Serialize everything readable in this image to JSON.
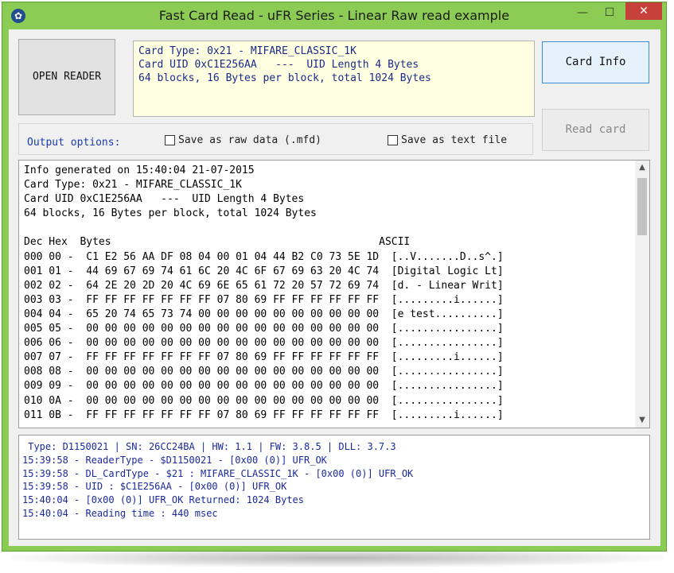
{
  "window": {
    "title": "Fast Card Read - uFR Series - Linear Raw read example",
    "icon": "paw-icon",
    "min_glyph": "—",
    "max_glyph": "☐",
    "close_glyph": "✕",
    "accent": "#8ccc55"
  },
  "buttons": {
    "open_reader": "OPEN READER",
    "card_info": "Card Info",
    "read_card": "Read card"
  },
  "card_info_box": [
    "Card Type: 0x21 - MIFARE_CLASSIC_1K",
    "Card UID 0xC1E256AA   ---  UID Length 4 Bytes",
    "64 blocks, 16 Bytes per block, total 1024 Bytes"
  ],
  "output_options": {
    "label": "Output options:",
    "save_raw": {
      "label": "Save as raw data (.mfd)",
      "checked": false
    },
    "save_text": {
      "label": "Save as text file",
      "checked": false
    }
  },
  "main_output": {
    "lines": [
      "Info generated on 15:40:04 21-07-2015",
      "Card Type: 0x21 - MIFARE_CLASSIC_1K",
      "Card UID 0xC1E256AA   ---  UID Length 4 Bytes",
      "64 blocks, 16 Bytes per block, total 1024 Bytes",
      "",
      "Dec Hex  Bytes                                           ASCII",
      "000 00 -  C1 E2 56 AA DF 08 04 00 01 04 44 B2 C0 73 5E 1D  [..V.......D..s^.]",
      "001 01 -  44 69 67 69 74 61 6C 20 4C 6F 67 69 63 20 4C 74  [Digital Logic Lt]",
      "002 02 -  64 2E 20 2D 20 4C 69 6E 65 61 72 20 57 72 69 74  [d. - Linear Writ]",
      "003 03 -  FF FF FF FF FF FF FF 07 80 69 FF FF FF FF FF FF  [.........i......]",
      "004 04 -  65 20 74 65 73 74 00 00 00 00 00 00 00 00 00 00  [e test..........]",
      "005 05 -  00 00 00 00 00 00 00 00 00 00 00 00 00 00 00 00  [................]",
      "006 06 -  00 00 00 00 00 00 00 00 00 00 00 00 00 00 00 00  [................]",
      "007 07 -  FF FF FF FF FF FF FF 07 80 69 FF FF FF FF FF FF  [.........i......]",
      "008 08 -  00 00 00 00 00 00 00 00 00 00 00 00 00 00 00 00  [................]",
      "009 09 -  00 00 00 00 00 00 00 00 00 00 00 00 00 00 00 00  [................]",
      "010 0A -  00 00 00 00 00 00 00 00 00 00 00 00 00 00 00 00  [................]",
      "011 0B -  FF FF FF FF FF FF FF 07 80 69 FF FF FF FF FF FF  [.........i......]"
    ]
  },
  "log": {
    "lines": [
      " Type: D1150021 | SN: 26CC24BA | HW: 1.1 | FW: 3.8.5 | DLL: 3.7.3",
      "15:39:58 - ReaderType - $D1150021 - [0x00 (0)] UFR_OK",
      "15:39:58 - DL_CardType - $21 : MIFARE_CLASSIC_1K - [0x00 (0)] UFR_OK",
      "15:39:58 - UID : $C1E256AA - [0x00 (0)] UFR_OK",
      "15:40:04 - [0x00 (0)] UFR_OK Returned: 1024 Bytes",
      "15:40:04 - Reading time : 440 msec"
    ]
  },
  "scrollbar": {
    "up_glyph": "▲",
    "down_glyph": "▼"
  }
}
